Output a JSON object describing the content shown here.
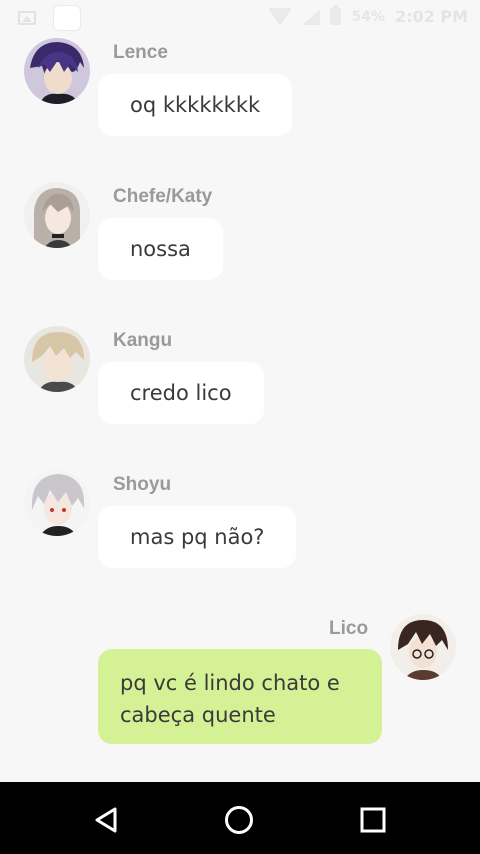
{
  "status_bar": {
    "battery": "54%",
    "time": "2:02 PM"
  },
  "messages": [
    {
      "user": "Lence",
      "text": "oq kkkkkkkk",
      "mine": false
    },
    {
      "user": "Chefe/Katy",
      "text": "nossa",
      "mine": false
    },
    {
      "user": "Kangu",
      "text": "credo lico",
      "mine": false
    },
    {
      "user": "Shoyu",
      "text": "mas pq não?",
      "mine": false
    },
    {
      "user": "Lico",
      "text": "pq vc é lindo chato e cabeça quente",
      "mine": true
    }
  ],
  "nav": {
    "back": "back-icon",
    "home": "home-icon",
    "recents": "recents-icon"
  },
  "colors": {
    "background": "#f7f7f7",
    "bubble_other": "#ffffff",
    "bubble_mine": "#d4f195",
    "username": "#9a9a9a",
    "navbar": "#000000"
  }
}
